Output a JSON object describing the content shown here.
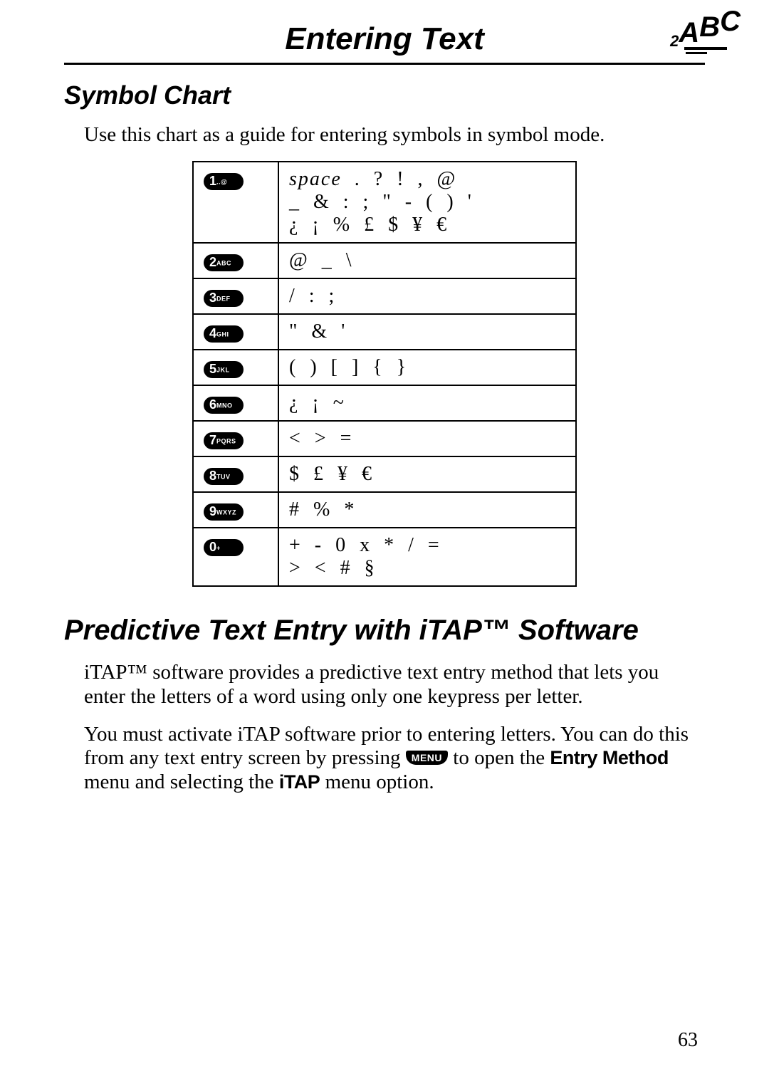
{
  "header": {
    "page_title": "Entering Text",
    "corner_icon_label": "abc-text-entry-icon"
  },
  "section1": {
    "title": "Symbol Chart",
    "intro": "Use this chart as a guide for entering symbols in symbol mode."
  },
  "chart": {
    "rows": [
      {
        "key_num": "1",
        "key_sub": "..@",
        "symbols_html": "<span class='italic'>space</span>  .  ?  !  ,  @\n_  &  :  ;  \"  -  (  )  '\n¿  ¡  %  £  $  ¥  €"
      },
      {
        "key_num": "2",
        "key_sub": "ABC",
        "symbols_html": "@  _  \\"
      },
      {
        "key_num": "3",
        "key_sub": "DEF",
        "symbols_html": "/  :  ;"
      },
      {
        "key_num": "4",
        "key_sub": "GHI",
        "symbols_html": "\"  &  '"
      },
      {
        "key_num": "5",
        "key_sub": "JKL",
        "symbols_html": "(  )  [  ]  {  }"
      },
      {
        "key_num": "6",
        "key_sub": "MNO",
        "symbols_html": "¿  ¡  ~"
      },
      {
        "key_num": "7",
        "key_sub": "PQRS",
        "symbols_html": "<  >  ="
      },
      {
        "key_num": "8",
        "key_sub": "TUV",
        "symbols_html": "$  £  ¥  €"
      },
      {
        "key_num": "9",
        "key_sub": "WXYZ",
        "symbols_html": "#  %  *"
      },
      {
        "key_num": "0",
        "key_sub": "+",
        "symbols_html": "+  -  0  x  *  /  =\n>  <  #  §"
      }
    ]
  },
  "section2": {
    "title": "Predictive Text Entry with iTAP™ Software",
    "para1": "iTAP™ software provides a predictive text entry method that lets you enter the letters of a word using only one keypress per letter.",
    "para2_pre": "You must activate iTAP software prior to entering letters. You can do this from any text entry screen by pressing ",
    "menu_key_label": "MENU",
    "para2_mid": " to open the ",
    "entry_method": "Entry Method",
    "para2_mid2": " menu and selecting the ",
    "itap": "iTAP",
    "para2_end": " menu option."
  },
  "page_number": "63"
}
